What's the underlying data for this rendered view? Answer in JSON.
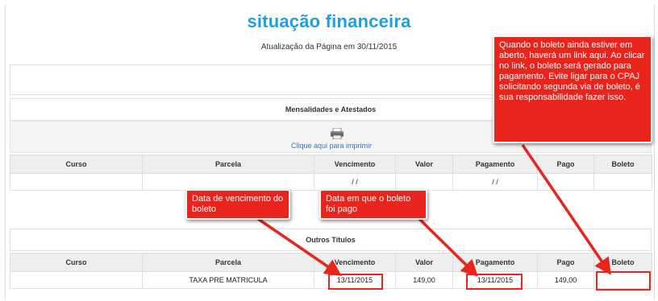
{
  "header": {
    "title": "situação financeira",
    "updated": "Atualização da Página em 30/11/2015"
  },
  "section1": {
    "title": "Mensalidades e Atestados",
    "print_icon": "printer-icon",
    "print_link": "Clique aqui para imprimir",
    "columns": [
      "Curso",
      "Parcela",
      "Vencimento",
      "Valor",
      "Pagamento",
      "Pago",
      "Boleto"
    ],
    "rows": [
      [
        "",
        "",
        "/ /",
        "",
        "/ /",
        "",
        ""
      ]
    ]
  },
  "section2": {
    "title": "Outros Títulos",
    "columns": [
      "Curso",
      "Parcela",
      "Vencimento",
      "Valor",
      "Pagamento",
      "Pago",
      "Boleto"
    ],
    "rows": [
      [
        "",
        "TAXA PRE MATRICULA",
        "13/11/2015",
        "149,00",
        "13/11/2015",
        "149,00",
        ""
      ]
    ]
  },
  "annotations": {
    "boleto_note": "Quando o boleto ainda estiver em aberto, haverá um link aqui. Ao clicar no link, o boleto será gerado para pagamento. Evite ligar para o CPAJ solicitando segunda via de boleto, é sua responsabilidade fazer isso.",
    "vencimento_note": "Data de vencimento do boleto",
    "pagamento_note": "Data em que o boleto foi pago"
  },
  "colors": {
    "title": "#1ea0e0",
    "annotation": "#e8241c",
    "link": "#3a78b8"
  }
}
